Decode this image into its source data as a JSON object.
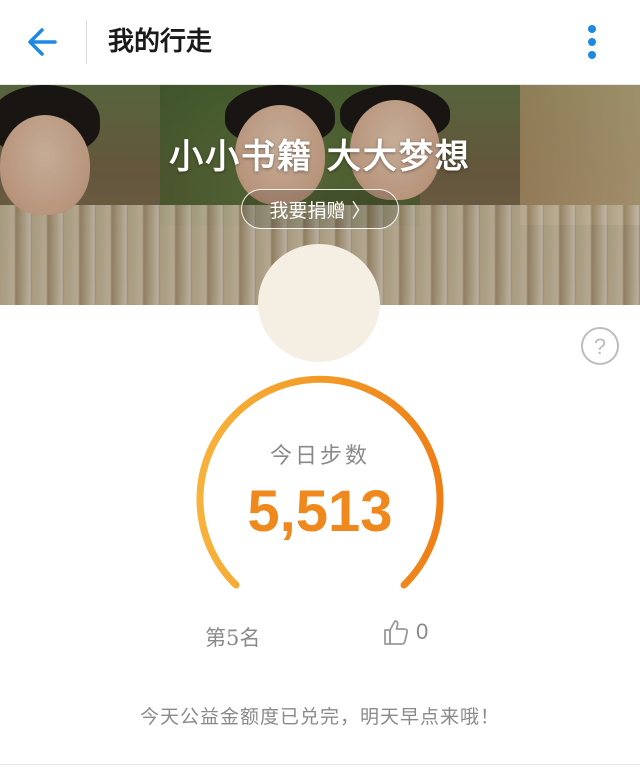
{
  "header": {
    "title": "我的行走",
    "back_icon": "arrow-left-icon",
    "more_icon": "vertical-dots-icon",
    "accent_color": "#1e88e5"
  },
  "banner": {
    "title": "小小书籍 大大梦想",
    "donate_label": "我要捐赠 〉"
  },
  "help_icon": "question-circle-icon",
  "steps": {
    "label": "今日步数",
    "value": "5,513",
    "color": "#f0891d"
  },
  "rank": {
    "label": "第5名"
  },
  "likes": {
    "icon": "thumbs-up-icon",
    "count": "0"
  },
  "notice": "今天公益金额度已兑完，明天早点来哦！"
}
